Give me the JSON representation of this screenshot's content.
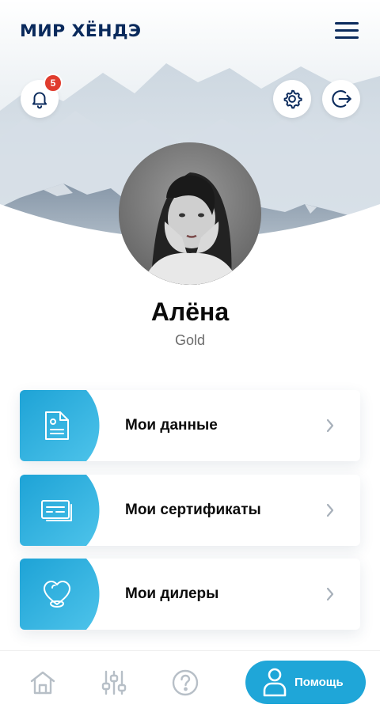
{
  "header": {
    "logo_text": "МИР ХЁНДЭ"
  },
  "notifications": {
    "count": "5"
  },
  "profile": {
    "name": "Алёна",
    "status": "Gold"
  },
  "menu": {
    "items": [
      {
        "label": "Мои данные",
        "icon": "document-icon"
      },
      {
        "label": "Мои сертификаты",
        "icon": "certificates-icon"
      },
      {
        "label": "Мои дилеры",
        "icon": "heart-pin-icon"
      }
    ]
  },
  "bottom_nav": {
    "items": [
      {
        "icon": "home-icon"
      },
      {
        "icon": "sliders-icon"
      },
      {
        "icon": "question-icon"
      }
    ],
    "help_label": "Помощь"
  },
  "colors": {
    "brand_navy": "#0a2a5c",
    "accent_blue": "#1fa6d8",
    "badge_red": "#e03c2e"
  }
}
